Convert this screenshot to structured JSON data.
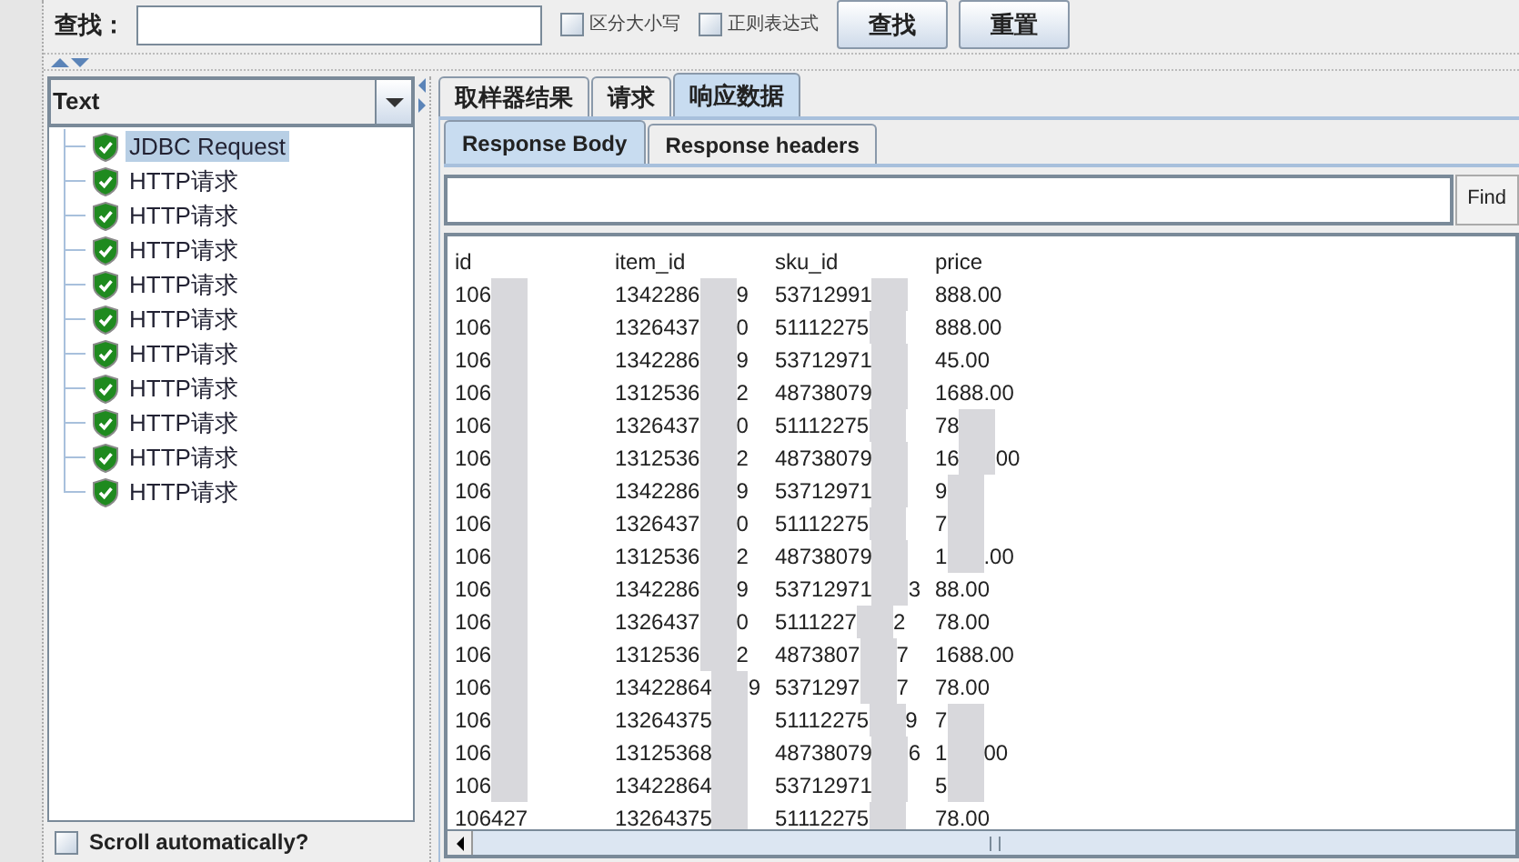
{
  "search": {
    "label": "查找：",
    "options": [
      {
        "label": "区分大小写",
        "checked": false
      },
      {
        "label": "正则表达式",
        "checked": false
      }
    ],
    "buttons": [
      "查找",
      "重置"
    ]
  },
  "renderer": {
    "value": "Text"
  },
  "tree": [
    {
      "label": "JDBC Request",
      "selected": true,
      "passed": true
    },
    {
      "label": "HTTP请求",
      "selected": false,
      "passed": true
    },
    {
      "label": "HTTP请求",
      "selected": false,
      "passed": true
    },
    {
      "label": "HTTP请求",
      "selected": false,
      "passed": true
    },
    {
      "label": "HTTP请求",
      "selected": false,
      "passed": true
    },
    {
      "label": "HTTP请求",
      "selected": false,
      "passed": true
    },
    {
      "label": "HTTP请求",
      "selected": false,
      "passed": true
    },
    {
      "label": "HTTP请求",
      "selected": false,
      "passed": true
    },
    {
      "label": "HTTP请求",
      "selected": false,
      "passed": true
    },
    {
      "label": "HTTP请求",
      "selected": false,
      "passed": true
    },
    {
      "label": "HTTP请求",
      "selected": false,
      "passed": true
    }
  ],
  "scroll_automatically": {
    "label": "Scroll automatically?",
    "checked": false
  },
  "tabs": [
    {
      "label": "取样器结果",
      "selected": false
    },
    {
      "label": "请求",
      "selected": false
    },
    {
      "label": "响应数据",
      "selected": true
    }
  ],
  "subtabs": [
    {
      "label": "Response Body",
      "selected": true
    },
    {
      "label": "Response headers",
      "selected": false
    }
  ],
  "find": {
    "button": "Find"
  },
  "table": {
    "columns": [
      "id",
      "item_id",
      "sku_id",
      "price"
    ],
    "rows": [
      [
        [
          "106"
        ],
        [
          "1342286",
          "9"
        ],
        [
          "53712991"
        ],
        "888.00"
      ],
      [
        [
          "106"
        ],
        [
          "1326437",
          "0"
        ],
        [
          "51112275"
        ],
        "888.00"
      ],
      [
        [
          "106"
        ],
        [
          "1342286",
          "9"
        ],
        [
          "53712971"
        ],
        "45.00"
      ],
      [
        [
          "106"
        ],
        [
          "1312536",
          "2"
        ],
        [
          "48738079"
        ],
        "1688.00"
      ],
      [
        [
          "106"
        ],
        [
          "1326437",
          "0"
        ],
        [
          "51112275"
        ],
        [
          "78"
        ]
      ],
      [
        [
          "106"
        ],
        [
          "1312536",
          "2"
        ],
        [
          "48738079"
        ],
        [
          "16",
          "00"
        ]
      ],
      [
        [
          "106"
        ],
        [
          "1342286",
          "9"
        ],
        [
          "53712971"
        ],
        [
          "9"
        ]
      ],
      [
        [
          "106"
        ],
        [
          "1326437",
          "0"
        ],
        [
          "51112275"
        ],
        [
          "7"
        ]
      ],
      [
        [
          "106"
        ],
        [
          "1312536",
          "2"
        ],
        [
          "48738079"
        ],
        [
          "1",
          ".00"
        ]
      ],
      [
        [
          "106"
        ],
        [
          "1342286",
          "9"
        ],
        [
          "53712971",
          "3"
        ],
        "88.00"
      ],
      [
        [
          "106"
        ],
        [
          "1326437",
          "0"
        ],
        [
          "5111227",
          "2"
        ],
        "78.00"
      ],
      [
        [
          "106"
        ],
        [
          "1312536",
          "2"
        ],
        [
          "4873807",
          "7"
        ],
        "1688.00"
      ],
      [
        [
          "106"
        ],
        [
          "13422864",
          "9"
        ],
        [
          "5371297",
          "7"
        ],
        "78.00"
      ],
      [
        [
          "106"
        ],
        [
          "13264375"
        ],
        [
          "51112275",
          "9"
        ],
        [
          "7"
        ]
      ],
      [
        [
          "106"
        ],
        [
          "13125368"
        ],
        [
          "48738079",
          "6"
        ],
        [
          "1",
          "00"
        ]
      ],
      [
        [
          "106"
        ],
        [
          "13422864"
        ],
        [
          "53712971"
        ],
        [
          "5"
        ]
      ],
      [
        "106427",
        [
          "13264375"
        ],
        [
          "51112275"
        ],
        "78.00"
      ]
    ]
  }
}
